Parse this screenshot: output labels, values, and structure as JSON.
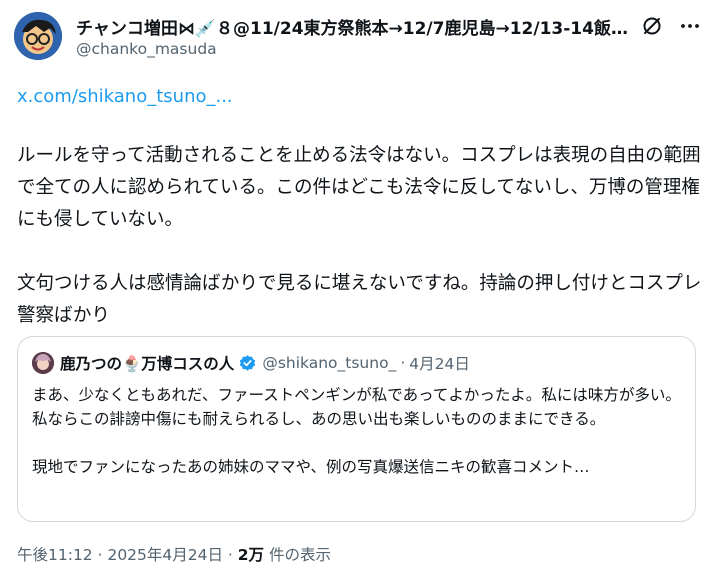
{
  "author": {
    "display_name": "チャンコ増田⋈💉８@11/24東方祭熊本→12/7鹿児島→12/13-14飯…",
    "handle": "@chanko_masuda"
  },
  "post": {
    "link_text": "x.com/shikano_tsuno_...",
    "paragraphs": [
      "ルールを守って活動されることを止める法令はない。コスプレは表現の自由の範囲で全ての人に認められている。この件はどこも法令に反してないし、万博の管理権にも侵していない。",
      "文句つける人は感情論ばかりで見るに堪えないですね。持論の押し付けとコスプレ警察ばかり"
    ]
  },
  "quoted": {
    "display_name": "鹿乃つの🍨万博コスの人",
    "handle": "@shikano_tsuno_",
    "separator": "·",
    "date": "4月24日",
    "paragraphs": [
      "まあ、少なくともあれだ、ファーストペンギンが私であってよかったよ。私には味方が多い。私ならこの誹謗中傷にも耐えられるし、あの思い出も楽しいもののままにできる。",
      "現地でファンになったあの姉妹のママや、例の写真爆送信ニキの歓喜コメント…"
    ]
  },
  "meta": {
    "time": "午後11:12",
    "sep1": " · ",
    "date": "2025年4月24日",
    "sep2": " · ",
    "views_count": "2万",
    "views_label": " 件の表示"
  },
  "icons": {
    "grok": "grok-icon",
    "more": "more-icon",
    "verified": "verified-badge-icon"
  },
  "colors": {
    "link": "#1d9bf0",
    "secondary_text": "#536471",
    "border": "#cfd9de",
    "verified": "#1d9bf0"
  }
}
